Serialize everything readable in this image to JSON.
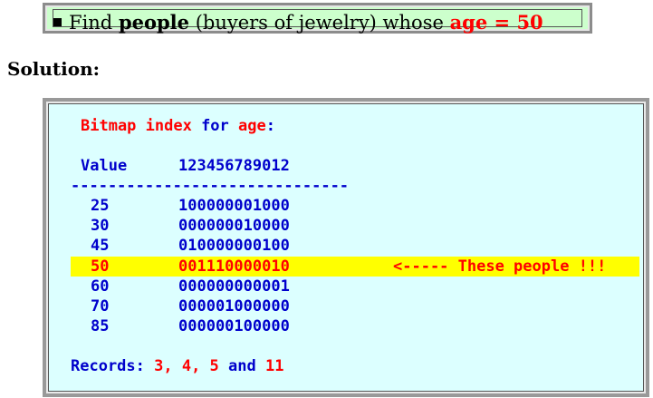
{
  "task": {
    "prefix": "Find ",
    "bold_word": "people",
    "middle": " (buyers of jewelry) whose ",
    "condition": "age = 50"
  },
  "solution_heading": "Solution:",
  "bitmap": {
    "title_part1": "Bitmap index",
    "title_part2": " for ",
    "title_part3": "age",
    "title_part4": ":",
    "header_value": "Value",
    "header_bits": "123456789012",
    "separator": "------------------------------",
    "rows": [
      {
        "value": "25",
        "bits": "100000001000"
      },
      {
        "value": "30",
        "bits": "000000010000"
      },
      {
        "value": "45",
        "bits": "010000000100"
      },
      {
        "value": "50",
        "bits": "001110000010"
      },
      {
        "value": "60",
        "bits": "000000000001"
      },
      {
        "value": "70",
        "bits": "000001000000"
      },
      {
        "value": "85",
        "bits": "000000100000"
      }
    ],
    "highlight_note": "<----- These people !!!",
    "records_label": "Records: ",
    "rec1": "3, 4, 5",
    "rec_and": " and ",
    "rec2": "11"
  },
  "colors": {
    "task_bg": "#ccffcc",
    "code_bg": "#dcffff",
    "code_text": "#0000cc",
    "accent_red": "#ff0000",
    "highlight": "#ffff00"
  }
}
